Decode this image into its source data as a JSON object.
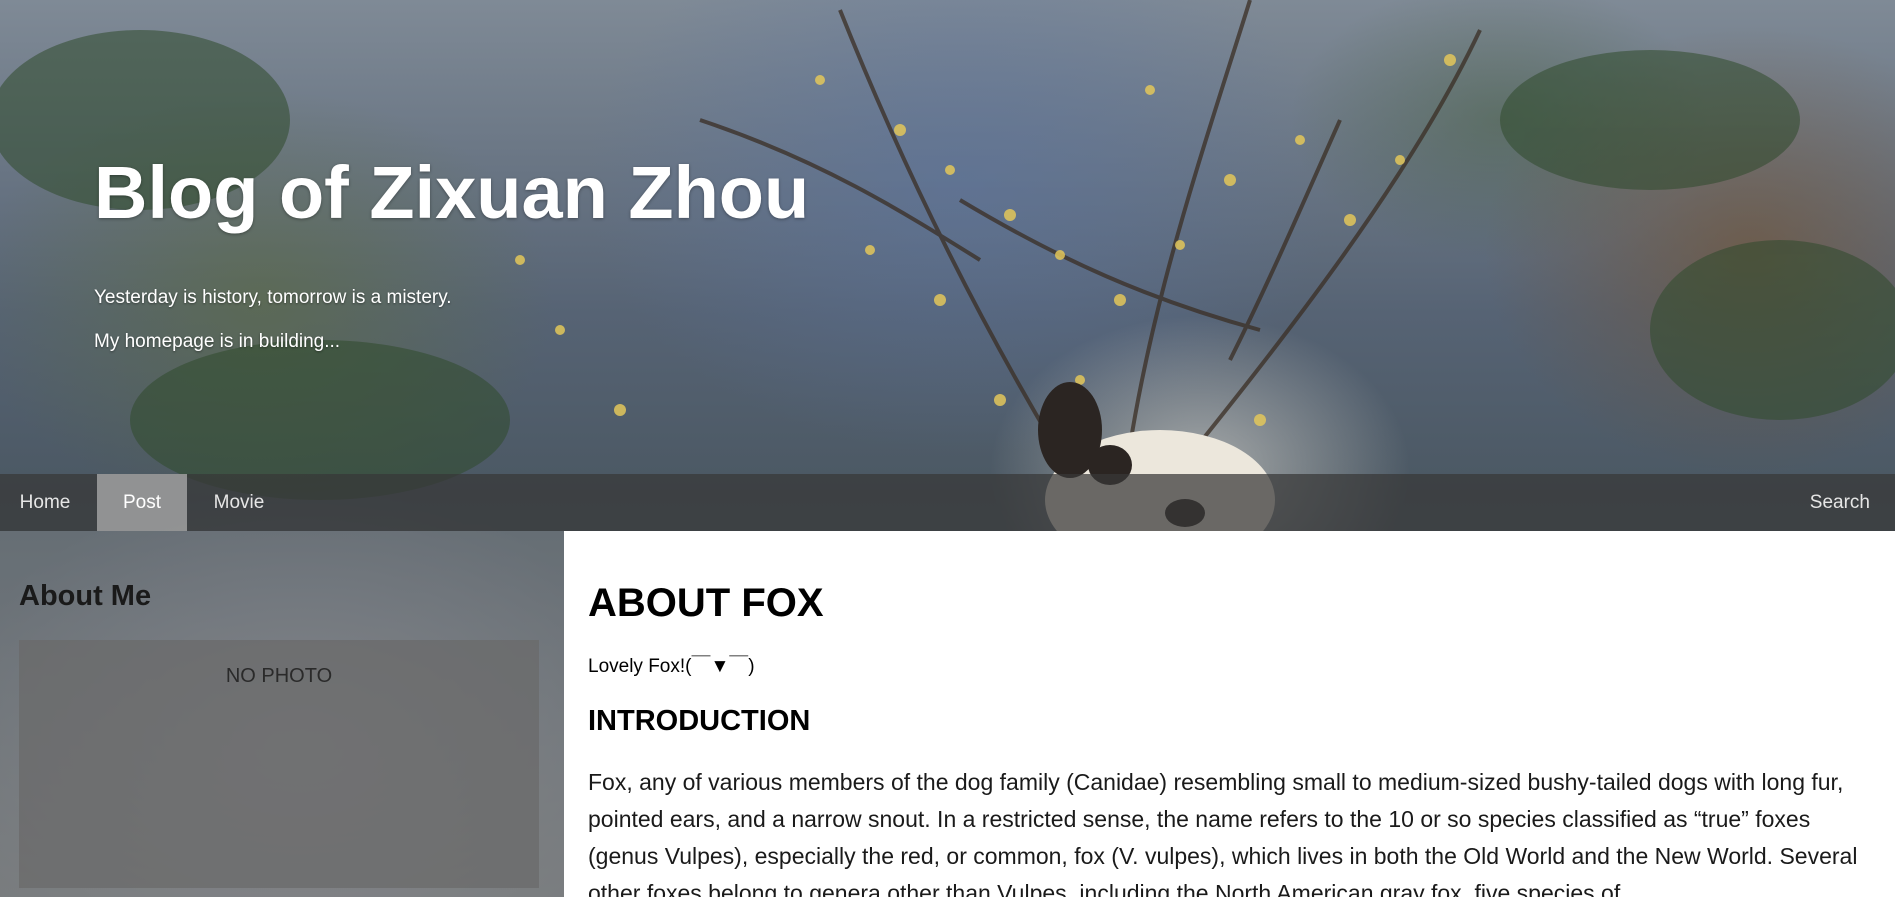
{
  "header": {
    "title": "Blog of Zixuan Zhou",
    "taglines": [
      "Yesterday is history, tomorrow is a mistery.",
      "My homepage is in building..."
    ]
  },
  "nav": {
    "items": [
      {
        "label": "Home",
        "active": false
      },
      {
        "label": "Post",
        "active": true
      },
      {
        "label": "Movie",
        "active": false
      }
    ],
    "search_label": "Search"
  },
  "sidebar": {
    "title": "About Me",
    "photo_placeholder": "NO PHOTO"
  },
  "post": {
    "title": "ABOUT FOX",
    "subtitle": "Lovely Fox!(￣▼￣)",
    "section_title": "INTRODUCTION",
    "body": "Fox, any of various members of the dog family (Canidae) resembling small to medium-sized bushy-tailed dogs with long fur, pointed ears, and a narrow snout. In a restricted sense, the name refers to the 10 or so species classified as “true” foxes (genus Vulpes), especially the red, or common, fox (V. vulpes), which lives in both the Old World and the New World. Several other foxes belong to genera other than Vulpes, including the North American gray fox, five species of"
  },
  "colors": {
    "nav_bar": "#373737",
    "nav_active": "#bebebe",
    "title_text": "#ffffff",
    "body_text": "#1a1a1a"
  }
}
